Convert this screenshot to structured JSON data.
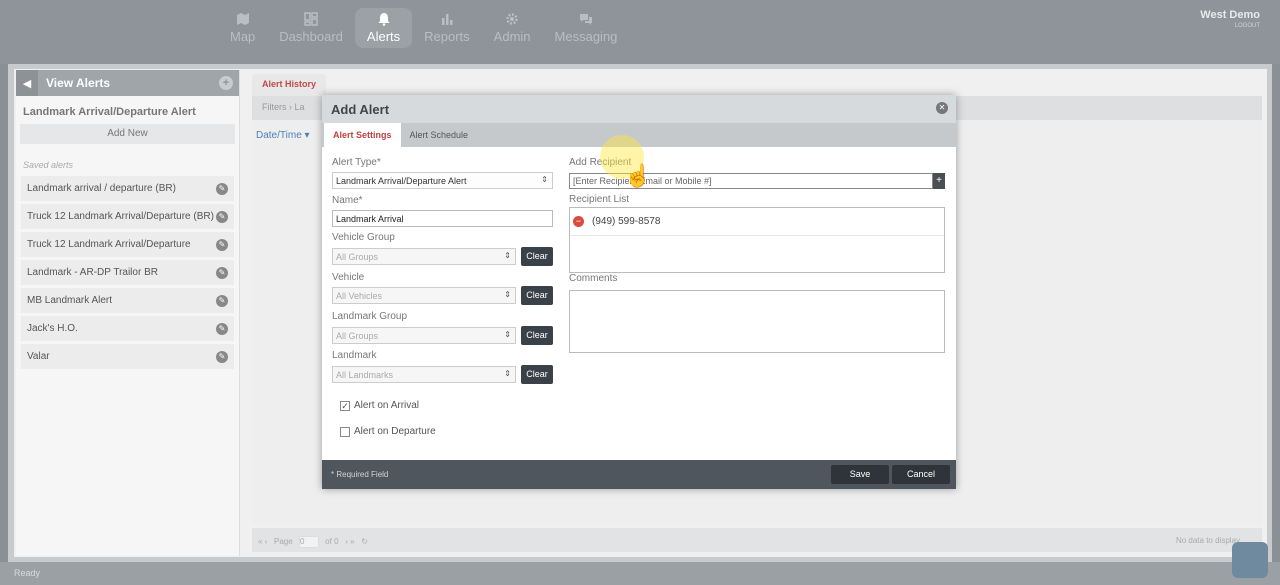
{
  "nav": {
    "items": [
      {
        "label": "Map",
        "icon": "map-icon"
      },
      {
        "label": "Dashboard",
        "icon": "dashboard-icon"
      },
      {
        "label": "Alerts",
        "icon": "bell-icon",
        "active": true
      },
      {
        "label": "Reports",
        "icon": "bar-chart-icon"
      },
      {
        "label": "Admin",
        "icon": "gear-icon"
      },
      {
        "label": "Messaging",
        "icon": "chat-icon"
      }
    ],
    "user_name": "West Demo",
    "logout": "LOGOUT"
  },
  "left": {
    "title": "View Alerts",
    "alert_type": "Landmark Arrival/Departure Alert",
    "add_new": "Add New",
    "saved_label": "Saved alerts",
    "saved": [
      "Landmark arrival / departure (BR)",
      "Truck 12 Landmark Arrival/Departure (BR)",
      "Truck 12 Landmark Arrival/Departure",
      "Landmark - AR-DP Trailor BR",
      "MB Landmark Alert",
      "Jack's H.O.",
      "Valar"
    ]
  },
  "background": {
    "tab": "Alert History",
    "filters": "Filters",
    "filters_crumb": "La",
    "datetime": "Date/Time",
    "page_label": "Page",
    "page_value": "0",
    "of_label": "of 0",
    "no_data": "No data to display",
    "status": "Ready"
  },
  "modal": {
    "title": "Add Alert",
    "tabs": [
      "Alert Settings",
      "Alert Schedule"
    ],
    "alert_type_label": "Alert Type*",
    "alert_type_value": "Landmark Arrival/Departure Alert",
    "name_label": "Name*",
    "name_value": "Landmark Arrival",
    "vehicle_group_label": "Vehicle Group",
    "vehicle_group_value": "All Groups",
    "vehicle_label": "Vehicle",
    "vehicle_value": "All Vehicles",
    "landmark_group_label": "Landmark Group",
    "landmark_group_value": "All Groups",
    "landmark_label": "Landmark",
    "landmark_value": "All Landmarks",
    "clear": "Clear",
    "alert_on_arrival": "Alert on Arrival",
    "alert_on_departure": "Alert on Departure",
    "add_recipient_label": "Add Recipient",
    "recipient_placeholder": "[Enter Recipient Email or Mobile #]",
    "recipient_list_label": "Recipient List",
    "recipients": [
      "(949) 599-8578"
    ],
    "comments_label": "Comments",
    "required_note": "* Required Field",
    "save": "Save",
    "cancel": "Cancel"
  }
}
